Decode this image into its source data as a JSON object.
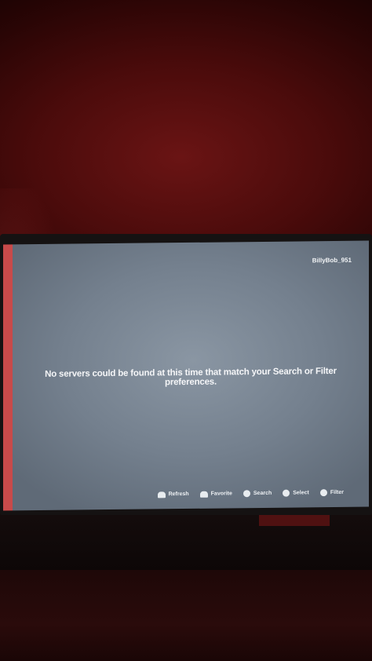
{
  "header": {
    "username": "BillyBob_951"
  },
  "main": {
    "message": "No servers could be found at this time that match your Search or Filter preferences."
  },
  "hints": [
    {
      "label": "Refresh",
      "icon": "left-bumper-icon"
    },
    {
      "label": "Favorite",
      "icon": "right-bumper-icon"
    },
    {
      "label": "Search",
      "icon": "x-button-icon"
    },
    {
      "label": "Select",
      "icon": "a-button-icon"
    },
    {
      "label": "Filter",
      "icon": "y-button-icon"
    }
  ],
  "colors": {
    "screen": "#74808e",
    "text": "#f4f5f7",
    "room_glow": "#6a1414"
  }
}
